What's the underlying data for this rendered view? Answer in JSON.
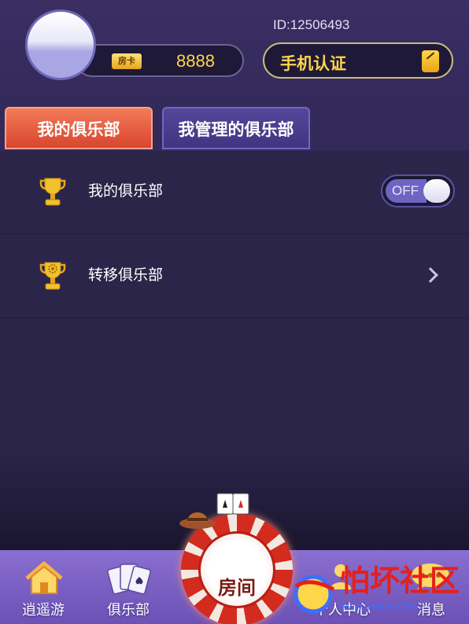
{
  "header": {
    "user_id": "ID:12506493",
    "room_card_badge": "房卡",
    "room_card_count": "8888",
    "verify_label": "手机认证"
  },
  "tabs": {
    "my_club": "我的俱乐部",
    "managed_club": "我管理的俱乐部",
    "active": "my_club"
  },
  "rows": [
    {
      "label": "我的俱乐部",
      "icon": "trophy-icon",
      "control": "toggle",
      "toggle_label": "OFF",
      "toggle_state": false
    },
    {
      "label": "转移俱乐部",
      "icon": "trophy-gear-icon",
      "control": "chevron"
    }
  ],
  "bottom_nav": {
    "home": "逍遥游",
    "club": "俱乐部",
    "room": "房间",
    "profile": "个人中心",
    "message": "消息"
  },
  "watermark": {
    "text": "怕坏社区",
    "url": "www.pahuai.com"
  },
  "colors": {
    "accent_gold": "#ffd54a",
    "active_tab": "#d9452f",
    "inactive_tab": "#403581",
    "background": "#2b2549",
    "nav": "#7a5fc6"
  }
}
